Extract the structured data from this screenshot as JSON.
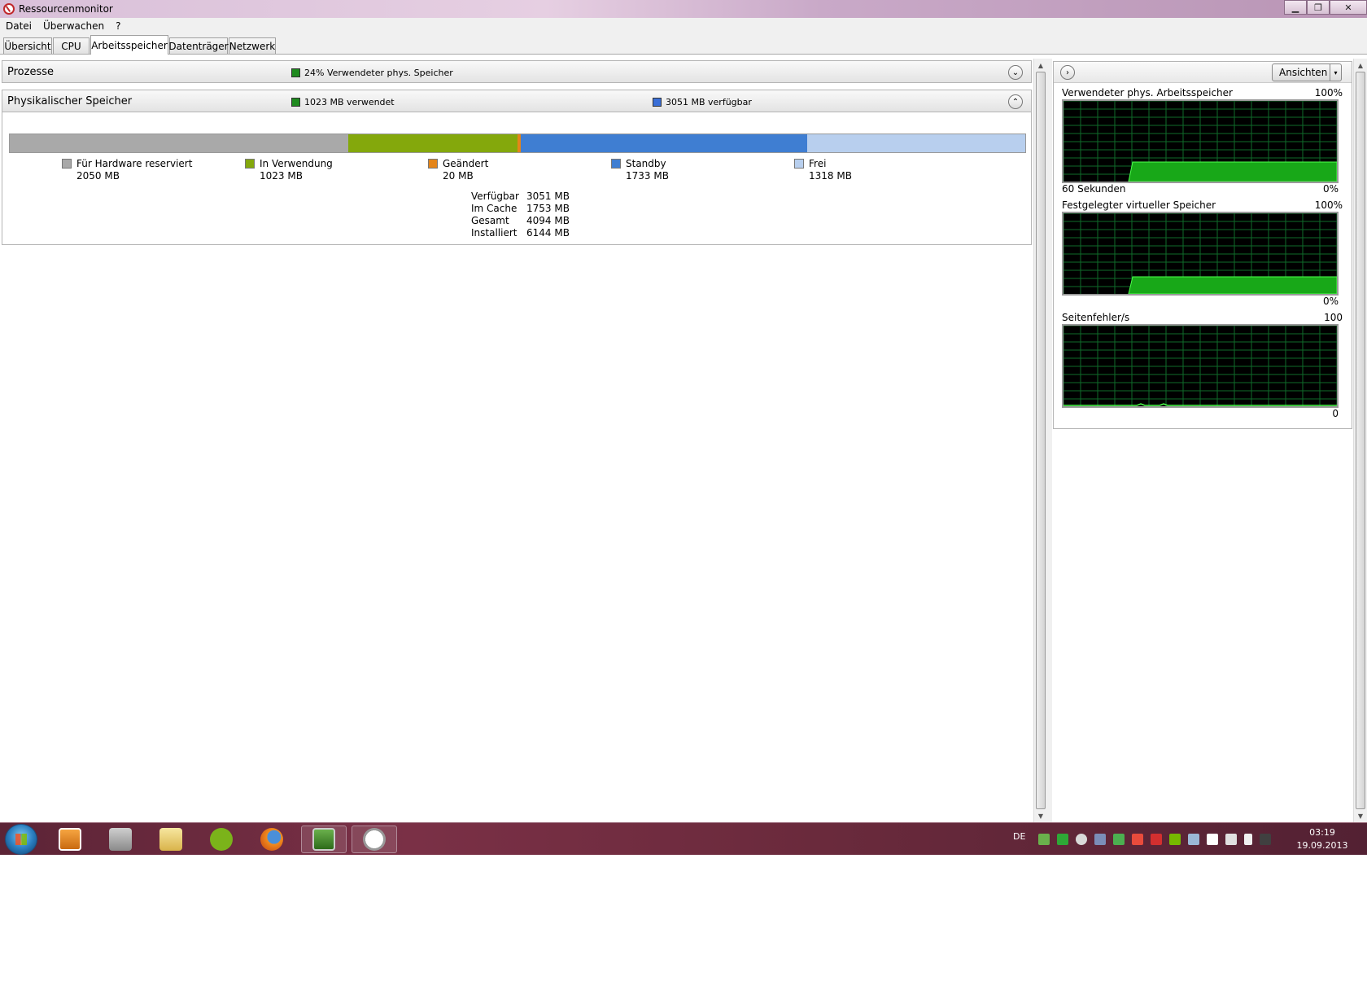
{
  "window": {
    "title": "Ressourcenmonitor",
    "buttons": {
      "minimize": "▁",
      "maximize": "❐",
      "close": "✕"
    }
  },
  "menu": [
    "Datei",
    "Überwachen",
    "?"
  ],
  "tabs": [
    "Übersicht",
    "CPU",
    "Arbeitsspeicher",
    "Datenträger",
    "Netzwerk"
  ],
  "active_tab": "Arbeitsspeicher",
  "sections": {
    "processes": {
      "label": "Prozesse",
      "stat": "24% Verwendeter phys. Speicher",
      "stat_color": "#1f8a1f",
      "toggle": "⌄"
    },
    "physical": {
      "label": "Physikalischer Speicher",
      "stat_used": "1023 MB verwendet",
      "stat_used_color": "#1f8a1f",
      "stat_avail": "3051 MB verfügbar",
      "stat_avail_color": "#3a6fd8",
      "toggle": "⌃"
    }
  },
  "memory_bar": [
    {
      "name": "Für Hardware reserviert",
      "value": "2050 MB",
      "mb": 2050,
      "color": "#a9a9a9"
    },
    {
      "name": "In Verwendung",
      "value": "1023 MB",
      "mb": 1023,
      "color": "#84a80c"
    },
    {
      "name": "Geändert",
      "value": "20 MB",
      "mb": 20,
      "color": "#e4851a"
    },
    {
      "name": "Standby",
      "value": "1733 MB",
      "mb": 1733,
      "color": "#3f7ed2"
    },
    {
      "name": "Frei",
      "value": "1318 MB",
      "mb": 1318,
      "color": "#b8cfee"
    }
  ],
  "summary": [
    {
      "key": "Verfügbar",
      "value": "3051 MB"
    },
    {
      "key": "Im Cache",
      "value": "1753 MB"
    },
    {
      "key": "Gesamt",
      "value": "4094 MB"
    },
    {
      "key": "Installiert",
      "value": "6144 MB"
    }
  ],
  "side_panel": {
    "expand_icon": "›",
    "views_button": "Ansichten",
    "views_dropdown": "▾",
    "graphs": [
      {
        "title": "Verwendeter phys. Arbeitsspeicher",
        "max": "100%",
        "foot_left": "60 Sekunden",
        "foot_right": "0%"
      },
      {
        "title": "Festgelegter virtueller Speicher",
        "max": "100%",
        "foot_left": "",
        "foot_right": "0%"
      },
      {
        "title": "Seitenfehler/s",
        "max": "100",
        "foot_left": "",
        "foot_right": "0"
      }
    ]
  },
  "taskbar": {
    "language": "DE",
    "time": "03:19",
    "date": "19.09.2013",
    "apps": [
      "media-player-icon",
      "jve-icon",
      "explorer-icon",
      "spotify-icon",
      "firefox-icon",
      "resource-monitor-task-icon",
      "clock-gadget-icon"
    ]
  }
}
